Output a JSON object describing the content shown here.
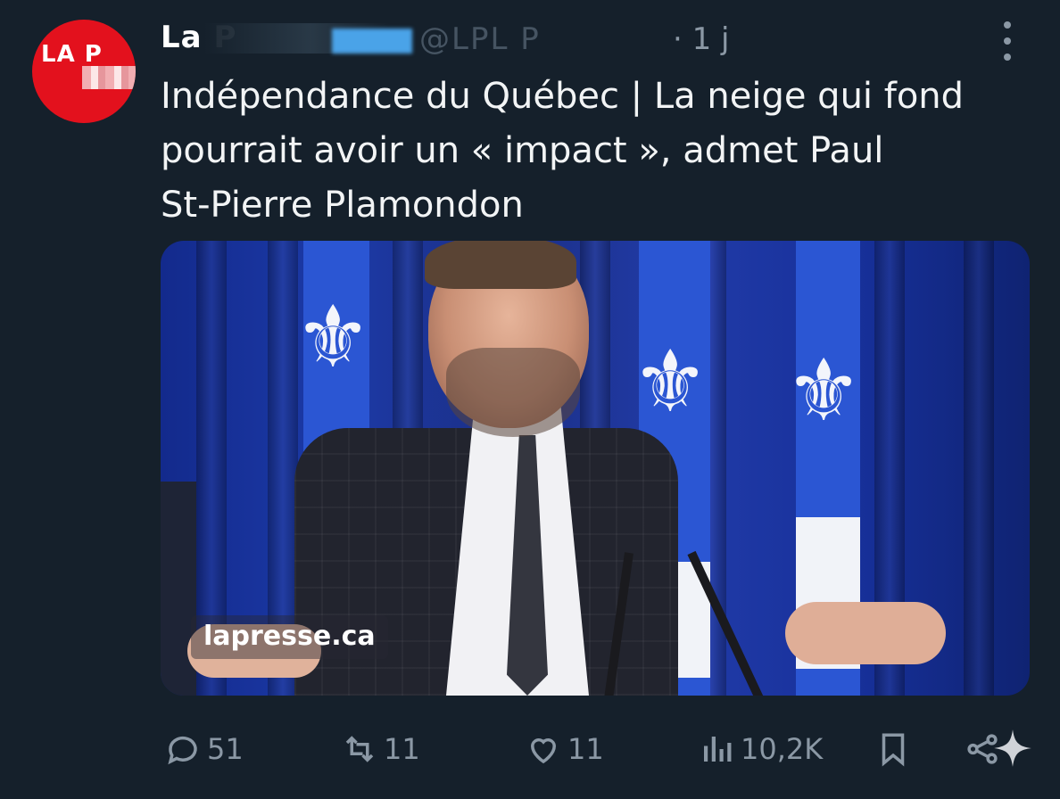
{
  "post": {
    "author_name": "La P",
    "handle": "@LPL P",
    "time": "· 1 j",
    "avatar_text": "LA P",
    "text_lines": [
      "Indépendance du Québec | La neige qui fond",
      "pourrait avoir un « impact », admet Paul",
      "St-Pierre Plamondon"
    ]
  },
  "media": {
    "watermark": "lapresse.ca"
  },
  "actions": {
    "replies": "51",
    "reposts": "11",
    "likes": "11",
    "views": "10,2K"
  },
  "icons": {
    "more": "more-vertical-icon",
    "reply": "comment-icon",
    "repost": "repost-icon",
    "like": "heart-icon",
    "views": "bar-chart-icon",
    "bookmark": "bookmark-icon",
    "share": "share-icon"
  },
  "colors": {
    "background": "#15202b",
    "muted": "#8b98a5",
    "avatar_red": "#e3111d",
    "flag_blue": "#2b56d3"
  }
}
